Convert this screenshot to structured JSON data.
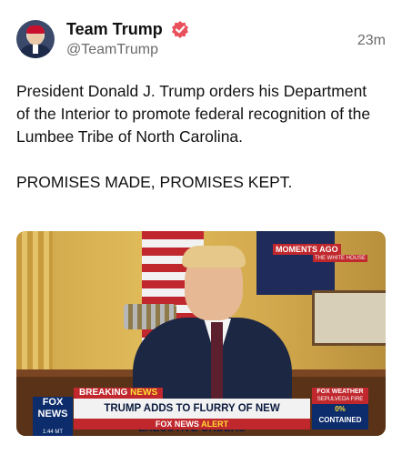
{
  "post": {
    "author_name": "Team Trump",
    "handle": "@TeamTrump",
    "timestamp": "23m",
    "paragraphs": [
      "President Donald J. Trump orders his Department of the Interior to promote federal recognition of the Lumbee Tribe of North Carolina.",
      "PROMISES MADE, PROMISES KEPT."
    ]
  },
  "media": {
    "moments_label": "MOMENTS AGO",
    "moments_sub": "THE WHITE HOUSE",
    "chyron": {
      "logo_top": "FOX",
      "logo_bottom": "NEWS",
      "clock": "1:44 MT",
      "breaking_prefix": "BREAKING",
      "breaking_suffix": "NEWS",
      "headline": "TRUMP ADDS TO FLURRY OF NEW EXECUTIVE ORDERS",
      "alert_prefix": "FOX NEWS",
      "alert_suffix": "ALERT",
      "weather_title": "FOX WEATHER",
      "weather_sub": "SEPULVEDA FIRE",
      "weather_pct": "0%",
      "weather_status": "CONTAINED"
    }
  },
  "icons": {
    "verified": "verified-badge-icon",
    "avatar": "profile-avatar"
  },
  "colors": {
    "verified_badge": "#e8505b",
    "text_secondary": "#6b6b6b",
    "fox_red": "#c0282d",
    "fox_blue": "#0d2c6c"
  }
}
